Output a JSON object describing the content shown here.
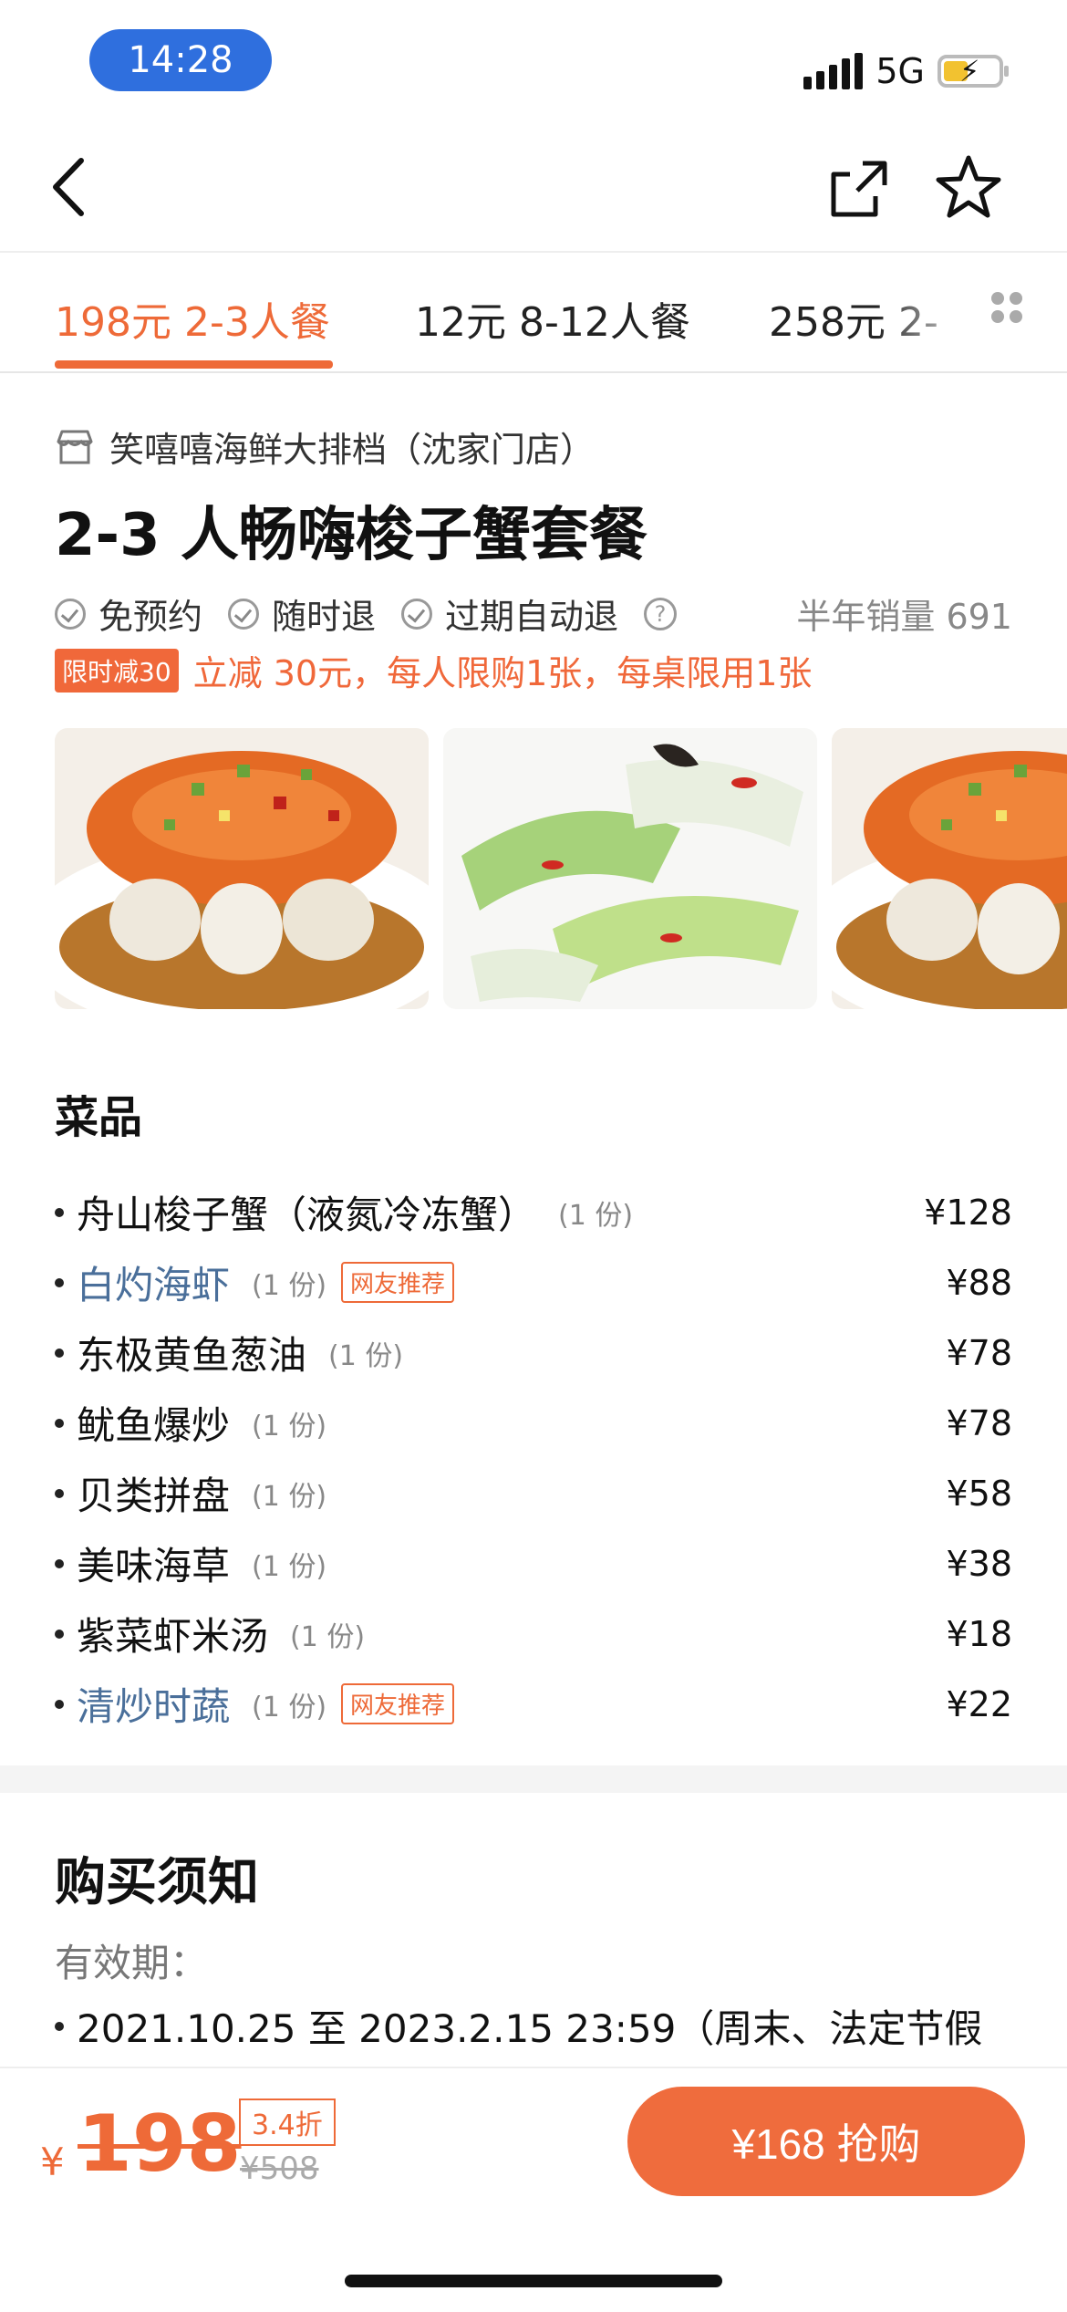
{
  "status_bar": {
    "time": "14:28",
    "network": "5G"
  },
  "tabs": [
    {
      "label": "198元 2-3人餐",
      "active": true
    },
    {
      "label": "12元 8-12人餐",
      "active": false
    },
    {
      "label": "258元 2-",
      "active": false
    }
  ],
  "shop": {
    "name": "笑嘻嘻海鲜大排档（沈家门店）"
  },
  "deal": {
    "title": "2-3 人畅嗨梭子蟹套餐",
    "features": [
      "免预约",
      "随时退",
      "过期自动退"
    ],
    "sales": "半年销量 691",
    "promo_tag": "限时减30",
    "promo_text": "立减 30元，每人限购1张，每桌限用1张"
  },
  "dishes_section": {
    "title": "菜品",
    "items": [
      {
        "name": "舟山梭子蟹（液氮冷冻蟹）",
        "qty": "(1 份)",
        "price": "¥128",
        "recommended": false
      },
      {
        "name": "白灼海虾",
        "qty": "(1 份)",
        "price": "¥88",
        "recommended": true,
        "badge": "网友推荐"
      },
      {
        "name": "东极黄鱼葱油",
        "qty": "(1 份)",
        "price": "¥78",
        "recommended": false
      },
      {
        "name": "鱿鱼爆炒",
        "qty": "(1 份)",
        "price": "¥78",
        "recommended": false
      },
      {
        "name": "贝类拼盘",
        "qty": "(1 份)",
        "price": "¥58",
        "recommended": false
      },
      {
        "name": "美味海草",
        "qty": "(1 份)",
        "price": "¥38",
        "recommended": false
      },
      {
        "name": "紫菜虾米汤",
        "qty": "(1 份)",
        "price": "¥18",
        "recommended": false
      },
      {
        "name": "清炒时蔬",
        "qty": "(1 份)",
        "price": "¥22",
        "recommended": true,
        "badge": "网友推荐"
      }
    ]
  },
  "notice": {
    "title": "购买须知",
    "validity_label": "有效期：",
    "validity_text": "2021.10.25 至 2023.2.15 23:59（周末、法定节假"
  },
  "bottom": {
    "currency": "¥",
    "price": "198",
    "discount": "3.4折",
    "original_price": "¥508",
    "buy_label": "¥168 抢购"
  },
  "colors": {
    "accent": "#ee6a38",
    "link_blue": "#4a6f9a",
    "status_pill": "#2f6fde"
  }
}
